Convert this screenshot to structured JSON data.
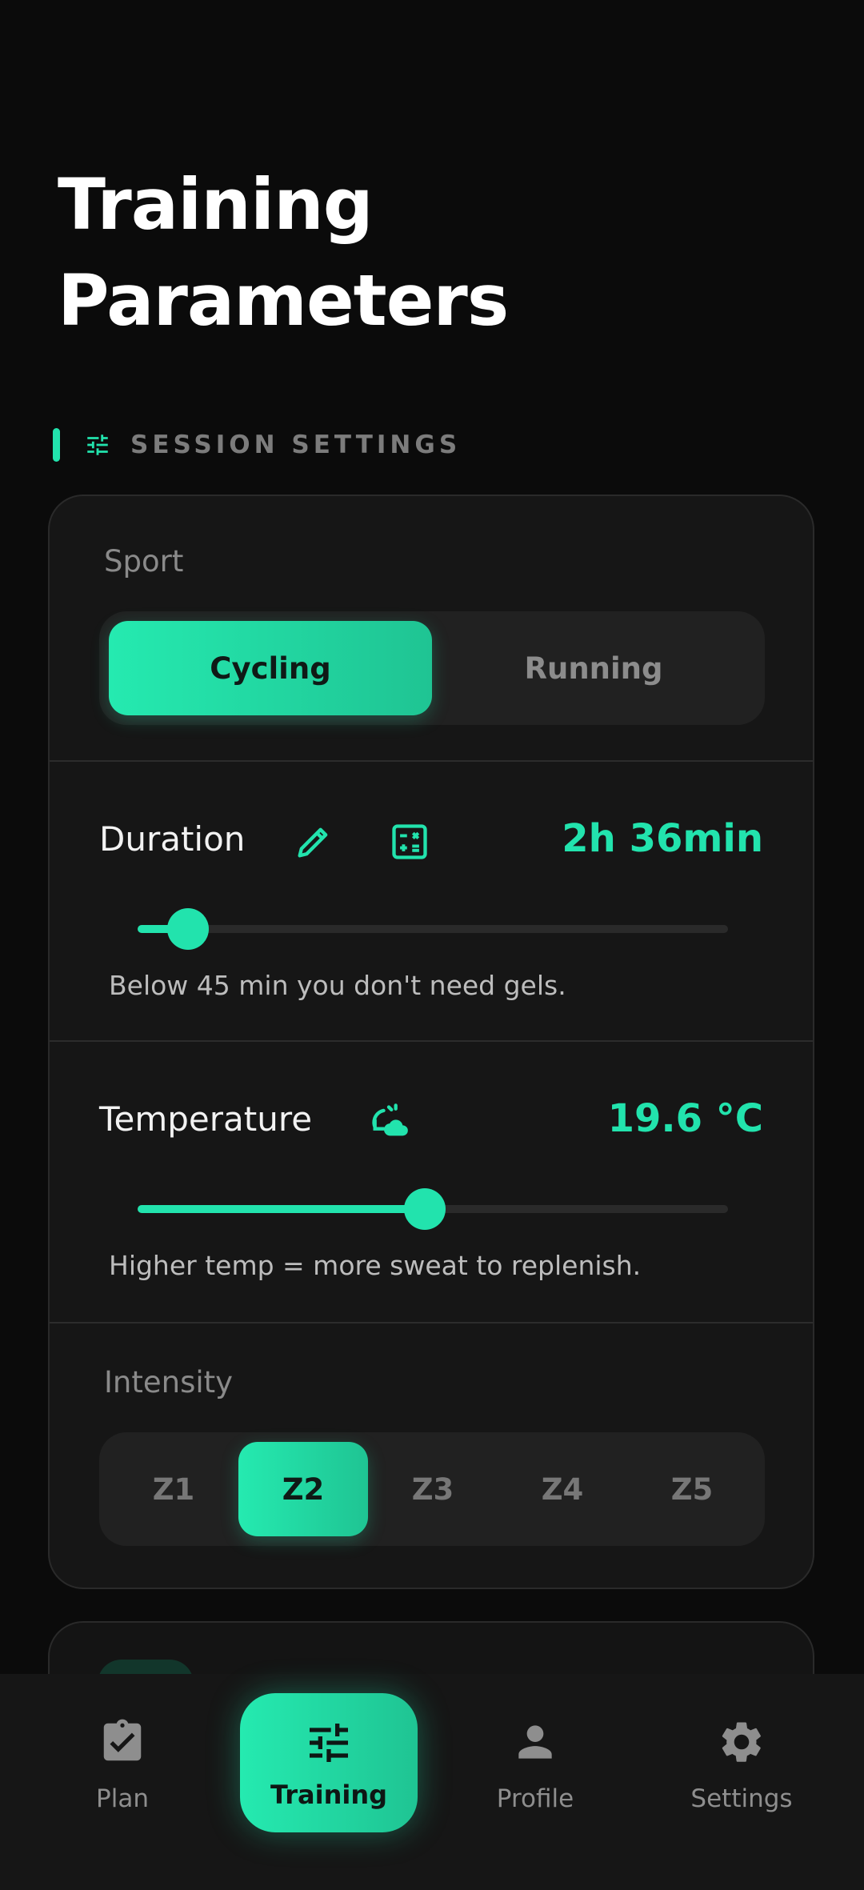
{
  "page": {
    "title_line1": "Training",
    "title_line2": "Parameters"
  },
  "section": {
    "label": "SESSION SETTINGS",
    "icon": "sliders-icon"
  },
  "sport": {
    "label": "Sport",
    "options": [
      "Cycling",
      "Running"
    ],
    "selected": "Cycling"
  },
  "duration": {
    "label": "Duration",
    "value": "2h 36min",
    "slider_fraction": 0.085,
    "hint": "Below 45 min you don't need gels.",
    "icons": [
      "pencil-icon",
      "calculator-icon"
    ]
  },
  "temperature": {
    "label": "Temperature",
    "value": "19.6 °C",
    "slider_fraction": 0.487,
    "hint": "Higher temp = more sweat to replenish.",
    "icons": [
      "weather-sync-icon"
    ]
  },
  "intensity": {
    "label": "Intensity",
    "options": [
      "Z1",
      "Z2",
      "Z3",
      "Z4",
      "Z5"
    ],
    "selected": "Z2"
  },
  "nav": {
    "items": [
      {
        "label": "Plan",
        "icon": "clipboard-check-icon"
      },
      {
        "label": "Training",
        "icon": "sliders-icon"
      },
      {
        "label": "Profile",
        "icon": "person-icon"
      },
      {
        "label": "Settings",
        "icon": "gear-icon"
      }
    ],
    "active": "Training"
  },
  "colors": {
    "accent": "#22e3ad",
    "background": "#0b0b0b",
    "card": "#161616"
  }
}
